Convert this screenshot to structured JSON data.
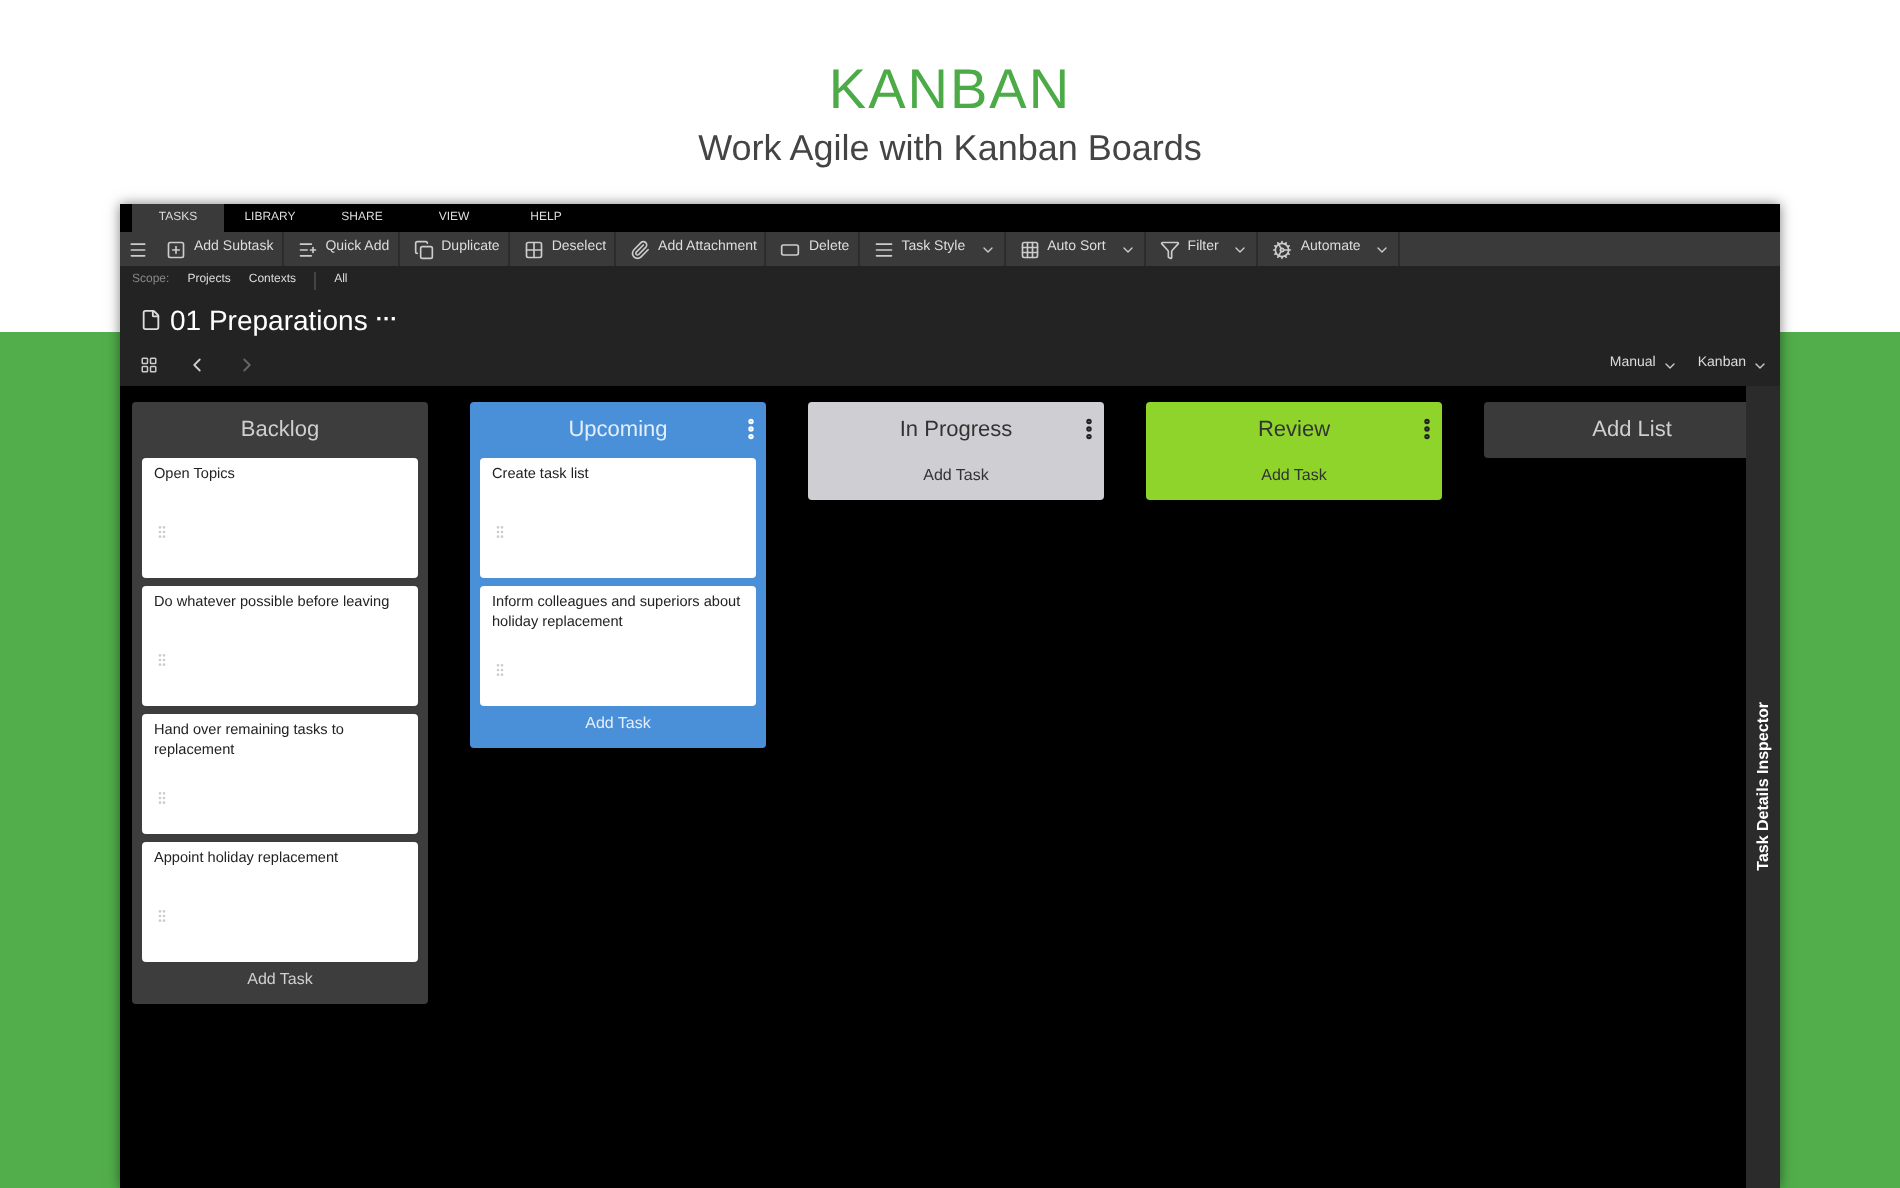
{
  "header": {
    "title": "KANBAN",
    "subtitle": "Work Agile with Kanban Boards"
  },
  "menu_tabs": [
    {
      "label": "TASKS",
      "selected": true
    },
    {
      "label": "LIBRARY",
      "selected": false
    },
    {
      "label": "SHARE",
      "selected": false
    },
    {
      "label": "VIEW",
      "selected": false
    },
    {
      "label": "HELP",
      "selected": false
    }
  ],
  "toolbar": [
    {
      "label": "Add Subtask",
      "dropdown": false
    },
    {
      "label": "Quick Add",
      "dropdown": false
    },
    {
      "label": "Duplicate",
      "dropdown": false
    },
    {
      "label": "Deselect",
      "dropdown": false
    },
    {
      "label": "Add Attachment",
      "dropdown": false
    },
    {
      "label": "Delete",
      "dropdown": false
    },
    {
      "label": "Task Style",
      "dropdown": true
    },
    {
      "label": "Auto Sort",
      "dropdown": true
    },
    {
      "label": "Filter",
      "dropdown": true
    },
    {
      "label": "Automate",
      "dropdown": true
    }
  ],
  "scope": {
    "label": "Scope:",
    "options": [
      "Projects",
      "Contexts",
      "All"
    ]
  },
  "project_title": "01 Preparations",
  "project_more": "···",
  "view_options": [
    "Manual",
    "Kanban"
  ],
  "lists": [
    {
      "kind": "list",
      "title": "Backlog",
      "color": "#3d3d3d",
      "menu": false,
      "cards": [
        "Open Topics",
        "Do whatever possible before leaving",
        "Hand over remaining tasks to replacement",
        "Appoint holiday replacement"
      ],
      "add_task": "Add Task"
    },
    {
      "kind": "list",
      "title": "Upcoming",
      "color": "#4a90d9",
      "menu": true,
      "cards": [
        "Create task list",
        "Inform colleagues and superiors about holiday replacement"
      ],
      "add_task": "Add Task"
    },
    {
      "kind": "list",
      "title": "In Progress",
      "color": "#cfcfd3",
      "menu": true,
      "add_task": "Add Task"
    },
    {
      "kind": "list",
      "title": "Review",
      "color": "#8fd42a",
      "menu": true,
      "add_task": "Add Task"
    },
    {
      "kind": "add",
      "title": "Add List"
    }
  ],
  "inspector": "Task Details Inspector"
}
